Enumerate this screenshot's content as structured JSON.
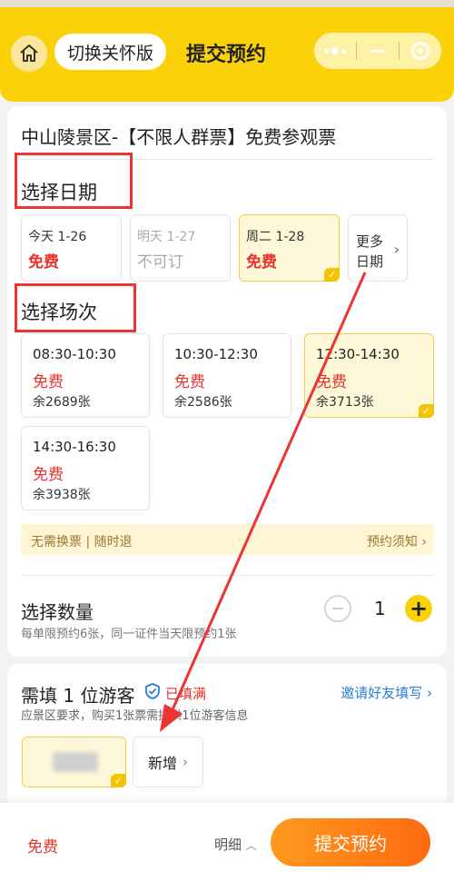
{
  "header": {
    "care_mode_label": "切换关怀版",
    "title": "提交预约",
    "accent_color": "#fbd20a"
  },
  "ticket": {
    "name": "中山陵景区-【不限人群票】免费参观票"
  },
  "date_section": {
    "title": "选择日期",
    "dates": [
      {
        "label": "今天 1-26",
        "price": "免费",
        "state": "available"
      },
      {
        "label": "明天 1-27",
        "price": "不可订",
        "state": "disabled"
      },
      {
        "label": "周二 1-28",
        "price": "免费",
        "state": "selected"
      }
    ],
    "more_label": "更多日期"
  },
  "session_section": {
    "title": "选择场次",
    "sessions": [
      {
        "time": "08:30-10:30",
        "price": "免费",
        "remaining": "余2689张",
        "state": "available"
      },
      {
        "time": "10:30-12:30",
        "price": "免费",
        "remaining": "余2586张",
        "state": "available"
      },
      {
        "time": "12:30-14:30",
        "price": "免费",
        "remaining": "余3713张",
        "state": "selected"
      },
      {
        "time": "14:30-16:30",
        "price": "免费",
        "remaining": "余3938张",
        "state": "available"
      }
    ]
  },
  "notice": {
    "left": "无需换票 | 随时退",
    "right": "预约须知"
  },
  "quantity": {
    "title": "选择数量",
    "subtitle": "每单限预约6张，同一证件当天限预约1张",
    "value": "1"
  },
  "visitors": {
    "title": "需填 1 位游客",
    "filled": "已填满",
    "invite": "邀请好友填写",
    "subtitle": "应景区要求，购买1张票需提供1位游客信息",
    "add_label": "新增"
  },
  "footer": {
    "total": "免费",
    "detail": "明细",
    "submit": "提交预约"
  },
  "icons": {
    "home": "home-icon",
    "more": "more-dots-icon",
    "minimize": "minimize-icon",
    "close": "close-target-icon",
    "shield": "verified-shield-icon",
    "check": "check-icon"
  },
  "colors": {
    "price_red": "#e8322b",
    "submit_orange": "#ff7a14",
    "link_blue": "#2a7fd4"
  }
}
